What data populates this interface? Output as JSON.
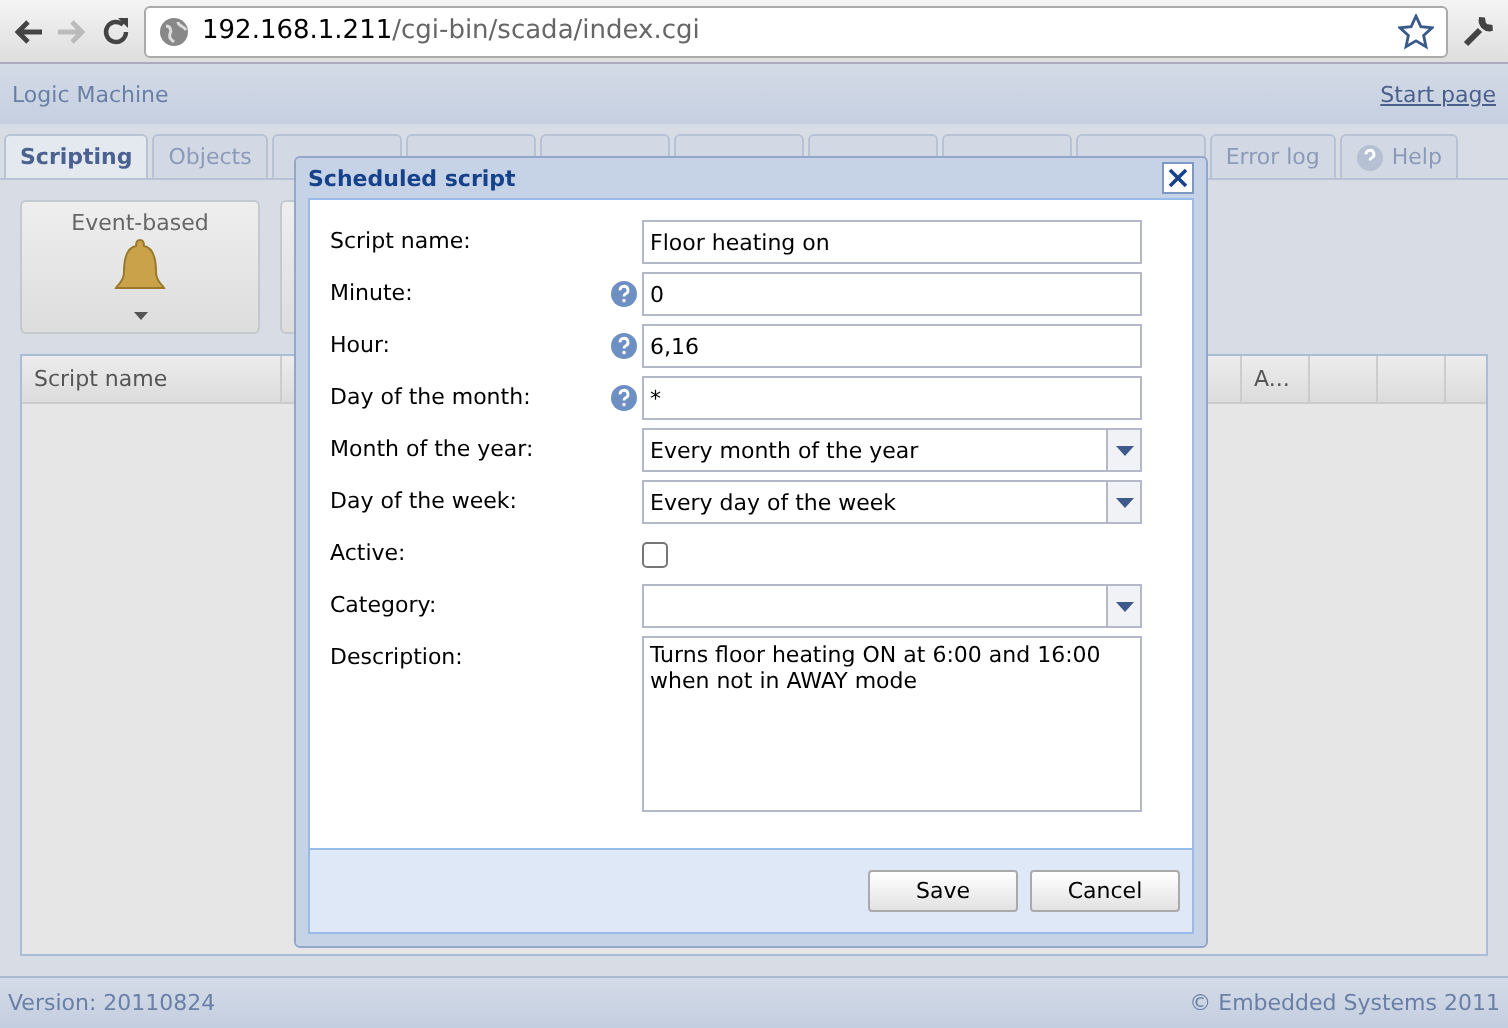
{
  "browser": {
    "url_host": "192.168.1.211",
    "url_path": "/cgi-bin/scada/index.cgi"
  },
  "header": {
    "title": "Logic Machine",
    "link": "Start page"
  },
  "tabs": [
    {
      "label": "Scripting",
      "selected": true,
      "covered": false
    },
    {
      "label": "Objects",
      "selected": false,
      "covered": false
    },
    {
      "selected": false,
      "covered": true
    },
    {
      "selected": false,
      "covered": true
    },
    {
      "selected": false,
      "covered": true
    },
    {
      "selected": false,
      "covered": true
    },
    {
      "selected": false,
      "covered": true
    },
    {
      "selected": false,
      "covered": true
    },
    {
      "selected": false,
      "covered": true
    },
    {
      "label": "Error log",
      "selected": false,
      "covered": false
    },
    {
      "label": "Help",
      "selected": false,
      "covered": false
    }
  ],
  "toolbar": {
    "buttons": [
      {
        "label": "Event-based"
      }
    ]
  },
  "table": {
    "columns": [
      "Script name",
      "A..."
    ]
  },
  "dialog": {
    "title": "Scheduled script",
    "fields": [
      {
        "kind": "text",
        "label": "Script name:",
        "value": "Floor heating on",
        "help": false
      },
      {
        "kind": "text",
        "label": "Minute:",
        "value": "0",
        "help": true
      },
      {
        "kind": "text",
        "label": "Hour:",
        "value": "6,16",
        "help": true
      },
      {
        "kind": "text",
        "label": "Day of the month:",
        "value": "*",
        "help": true
      },
      {
        "kind": "select",
        "label": "Month of the year:",
        "value": "Every month of the year",
        "help": false
      },
      {
        "kind": "select",
        "label": "Day of the week:",
        "value": "Every day of the week",
        "help": false
      },
      {
        "kind": "checkbox",
        "label": "Active:",
        "checked": false,
        "help": false
      },
      {
        "kind": "select",
        "label": "Category:",
        "help": false
      },
      {
        "kind": "textarea",
        "label": "Description:",
        "value": "Turns floor heating ON at 6:00 and 16:00 when not in AWAY mode",
        "help": false
      }
    ],
    "buttons": [
      "Save",
      "Cancel"
    ]
  },
  "status_bar": {
    "version": "Version: 20110824",
    "copyright": "© Embedded Systems 2011"
  }
}
